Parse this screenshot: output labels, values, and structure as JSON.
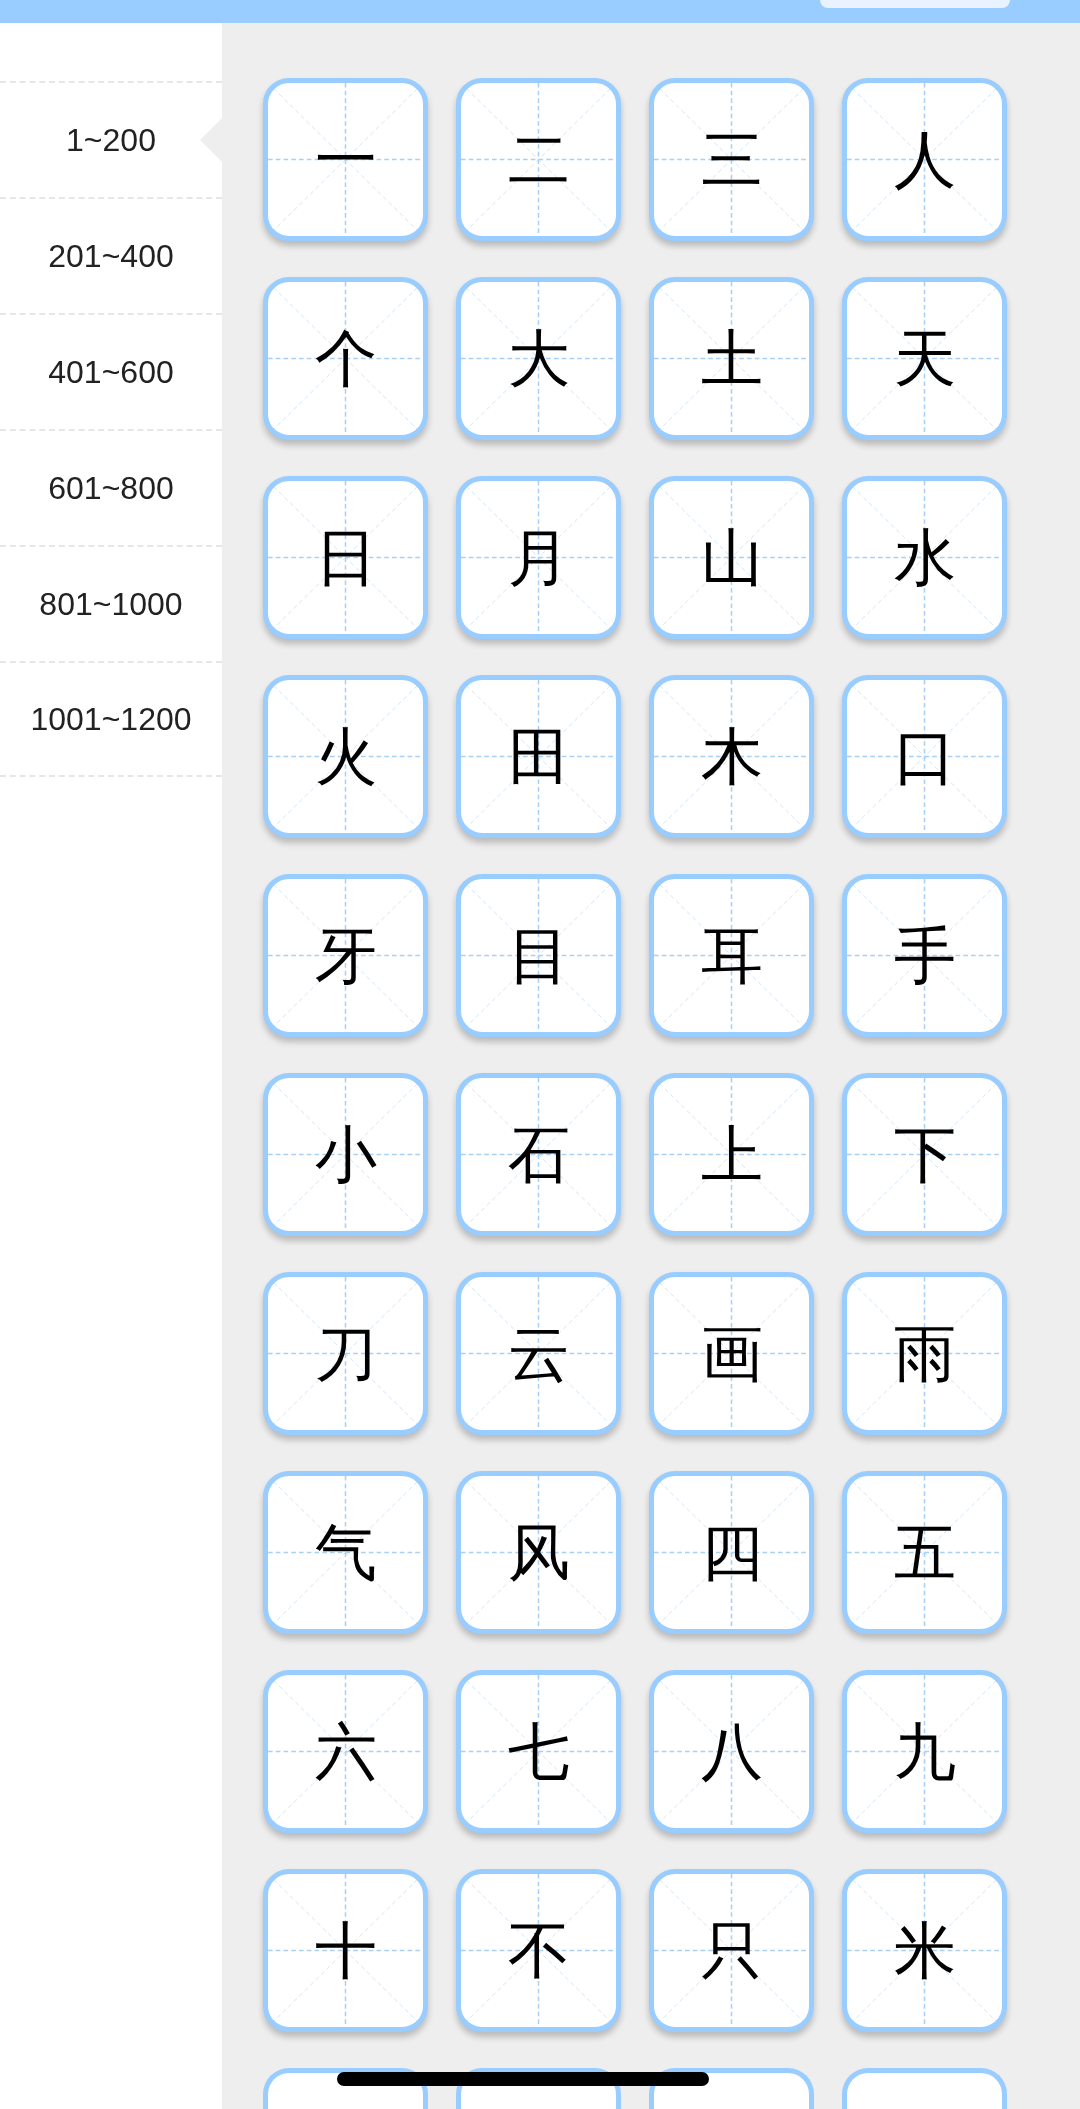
{
  "sidebar": {
    "items": [
      {
        "label": "1~200",
        "selected": true
      },
      {
        "label": "201~400",
        "selected": false
      },
      {
        "label": "401~600",
        "selected": false
      },
      {
        "label": "601~800",
        "selected": false
      },
      {
        "label": "801~1000",
        "selected": false
      },
      {
        "label": "1001~1200",
        "selected": false
      }
    ]
  },
  "cards": [
    {
      "kind": "char",
      "char": "一"
    },
    {
      "kind": "char",
      "char": "二"
    },
    {
      "kind": "char",
      "char": "三"
    },
    {
      "kind": "char",
      "char": "人"
    },
    {
      "kind": "char",
      "char": "个"
    },
    {
      "kind": "char",
      "char": "大"
    },
    {
      "kind": "char",
      "char": "土"
    },
    {
      "kind": "char",
      "char": "天"
    },
    {
      "kind": "char",
      "char": "日"
    },
    {
      "kind": "char",
      "char": "月"
    },
    {
      "kind": "char",
      "char": "山"
    },
    {
      "kind": "char",
      "char": "水"
    },
    {
      "kind": "char",
      "char": "火"
    },
    {
      "kind": "char",
      "char": "田"
    },
    {
      "kind": "char",
      "char": "木"
    },
    {
      "kind": "char",
      "char": "口"
    },
    {
      "kind": "char",
      "char": "牙"
    },
    {
      "kind": "char",
      "char": "目"
    },
    {
      "kind": "char",
      "char": "耳"
    },
    {
      "kind": "char",
      "char": "手"
    },
    {
      "kind": "char",
      "char": "小"
    },
    {
      "kind": "char",
      "char": "石"
    },
    {
      "kind": "char",
      "char": "上"
    },
    {
      "kind": "char",
      "char": "下"
    },
    {
      "kind": "char",
      "char": "刀"
    },
    {
      "kind": "char",
      "char": "云"
    },
    {
      "kind": "char",
      "char": "画"
    },
    {
      "kind": "char",
      "char": "雨"
    },
    {
      "kind": "char",
      "char": "气"
    },
    {
      "kind": "char",
      "char": "风"
    },
    {
      "kind": "char",
      "char": "四"
    },
    {
      "kind": "char",
      "char": "五"
    },
    {
      "kind": "char",
      "char": "六"
    },
    {
      "kind": "char",
      "char": "七"
    },
    {
      "kind": "char",
      "char": "八"
    },
    {
      "kind": "char",
      "char": "九"
    },
    {
      "kind": "char",
      "char": "十"
    },
    {
      "kind": "char",
      "char": "不"
    },
    {
      "kind": "char",
      "char": "只"
    },
    {
      "kind": "char",
      "char": "米"
    },
    {
      "kind": "cut"
    },
    {
      "kind": "cut"
    },
    {
      "kind": "cut"
    },
    {
      "kind": "cut"
    }
  ]
}
